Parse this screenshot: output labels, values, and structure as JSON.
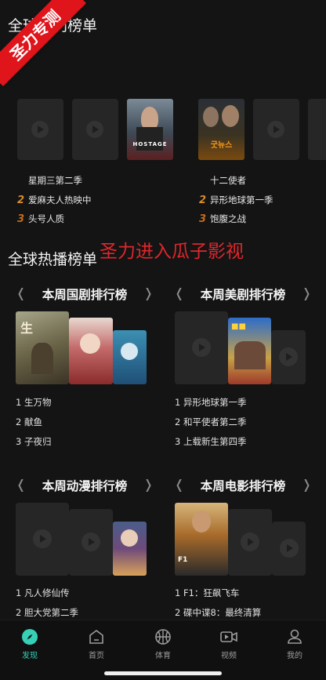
{
  "ribbon": {
    "text": "圣力专测"
  },
  "section_top": {
    "title": "全球热门榜单",
    "title_visible": "全球热门榜单"
  },
  "top_rows": {
    "left": [
      {
        "rank": "",
        "title": "星期三第二季"
      },
      {
        "rank": "2",
        "title": "爱麻夫人热映中"
      },
      {
        "rank": "3",
        "title": "头号人质"
      }
    ],
    "right": [
      {
        "rank": "",
        "title": "十二使者"
      },
      {
        "rank": "2",
        "title": "异形地球第一季"
      },
      {
        "rank": "3",
        "title": "饱腹之战"
      }
    ],
    "poster_left_caption": "HOSTAGE",
    "poster_right_caption": "굿뉴스"
  },
  "section_global": {
    "title": "全球热播榜单"
  },
  "promo_overlay": "圣力进入瓜子影视",
  "boards": [
    {
      "title": "本周国剧排行榜",
      "items": [
        "1 生万物",
        "2 献鱼",
        "3 子夜归"
      ]
    },
    {
      "title": "本周美剧排行榜",
      "items": [
        "1 异形地球第一季",
        "2 和平使者第二季",
        "3 上载新生第四季"
      ]
    },
    {
      "title": "本周动漫排行榜",
      "items": [
        "1 凡人修仙传",
        "2 胆大党第二季"
      ]
    },
    {
      "title": "本周电影排行榜",
      "items": [
        "1 F1：狂飙飞车",
        "2 碟中谍8：最终清算"
      ]
    }
  ],
  "tabs": [
    {
      "label": "发现",
      "icon": "compass-icon",
      "active": true
    },
    {
      "label": "首页",
      "icon": "home-icon",
      "active": false
    },
    {
      "label": "体育",
      "icon": "basketball-icon",
      "active": false
    },
    {
      "label": "视频",
      "icon": "video-icon",
      "active": false
    },
    {
      "label": "我的",
      "icon": "profile-icon",
      "active": false
    }
  ],
  "colors": {
    "accent": "#36d0b6",
    "ribbon": "#e0141b",
    "promo": "#e0262c",
    "background": "#141414"
  }
}
